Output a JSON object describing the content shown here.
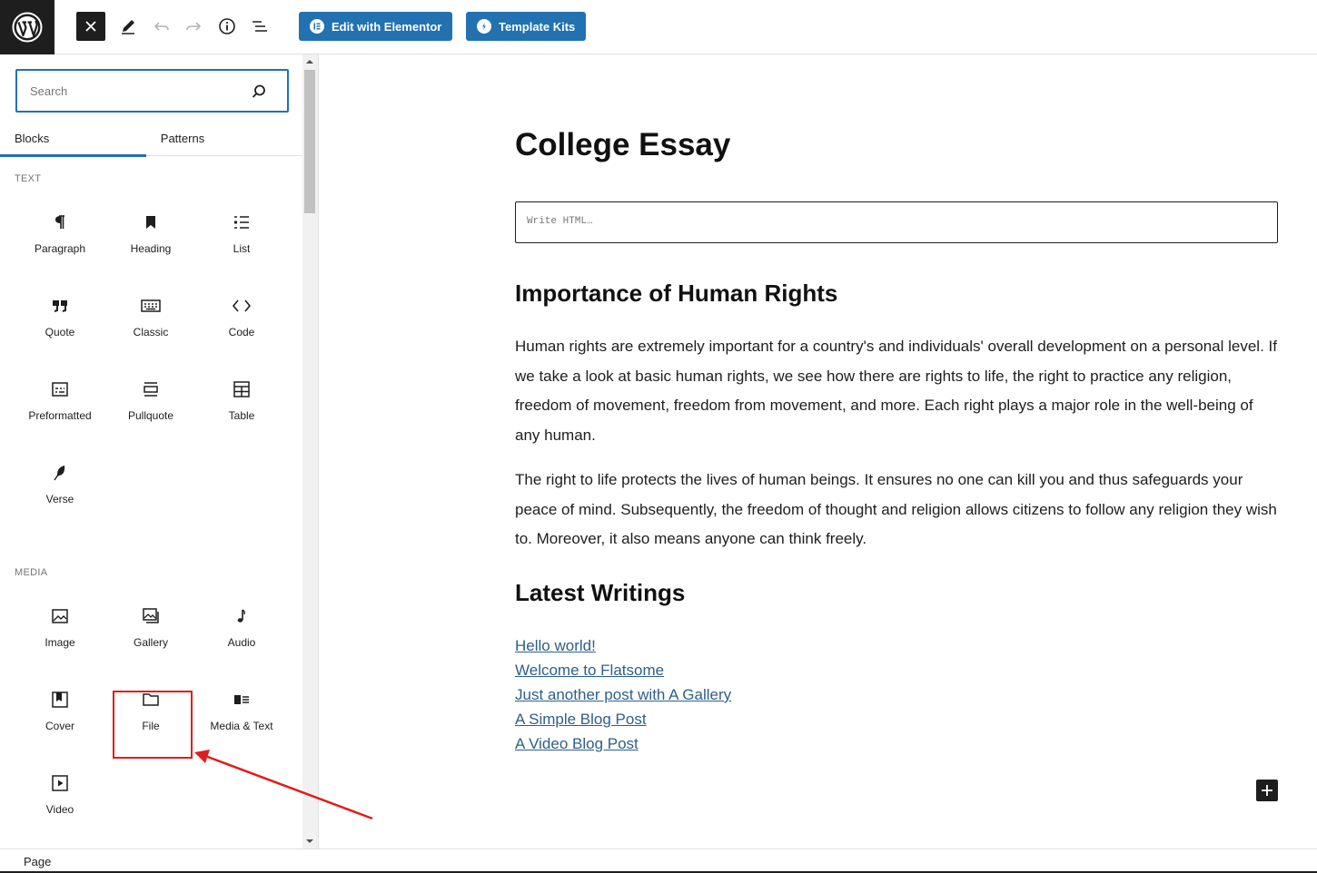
{
  "toolbar": {
    "elementor_label": "Edit with Elementor",
    "template_kits_label": "Template Kits"
  },
  "inserter": {
    "search_placeholder": "Search",
    "tabs": [
      "Blocks",
      "Patterns"
    ],
    "categories": [
      {
        "label": "TEXT",
        "blocks": [
          {
            "label": "Paragraph",
            "icon": "paragraph-icon"
          },
          {
            "label": "Heading",
            "icon": "heading-icon"
          },
          {
            "label": "List",
            "icon": "list-icon"
          },
          {
            "label": "Quote",
            "icon": "quote-icon"
          },
          {
            "label": "Classic",
            "icon": "keyboard-icon"
          },
          {
            "label": "Code",
            "icon": "code-icon"
          },
          {
            "label": "Preformatted",
            "icon": "preformatted-icon"
          },
          {
            "label": "Pullquote",
            "icon": "pullquote-icon"
          },
          {
            "label": "Table",
            "icon": "table-icon"
          },
          {
            "label": "Verse",
            "icon": "quill-icon"
          }
        ]
      },
      {
        "label": "MEDIA",
        "blocks": [
          {
            "label": "Image",
            "icon": "image-icon"
          },
          {
            "label": "Gallery",
            "icon": "gallery-icon"
          },
          {
            "label": "Audio",
            "icon": "audio-icon"
          },
          {
            "label": "Cover",
            "icon": "cover-icon"
          },
          {
            "label": "File",
            "icon": "folder-icon"
          },
          {
            "label": "Media & Text",
            "icon": "media-text-icon"
          },
          {
            "label": "Video",
            "icon": "video-icon"
          }
        ]
      }
    ]
  },
  "document": {
    "title": "College Essay",
    "html_placeholder": "Write HTML…",
    "heading_1": "Importance of Human Rights",
    "paragraph_1": "Human rights are extremely important for a country's and individuals' overall development on a personal level. If we take a look at basic human rights, we see how there are rights to life, the right to practice any religion, freedom of movement, freedom from movement, and more. Each right plays a major role in the well-being of any human.",
    "paragraph_2": "The right to life protects the lives of human beings. It ensures no one can kill you and thus safeguards your peace of mind. Subsequently, the freedom of thought and religion allows citizens to follow any religion they wish to. Moreover, it also means anyone can think freely.",
    "heading_2": "Latest Writings",
    "latest_posts": [
      "Hello world!",
      "Welcome to Flatsome",
      "Just another post with A Gallery",
      "A Simple Blog Post",
      "A Video Blog Post"
    ]
  },
  "footer": {
    "breadcrumb": "Page"
  },
  "colors": {
    "accent": "#2271b1",
    "annotation": "#e11d1d",
    "dark": "#1e1e1e",
    "link": "#2d5f8a"
  }
}
